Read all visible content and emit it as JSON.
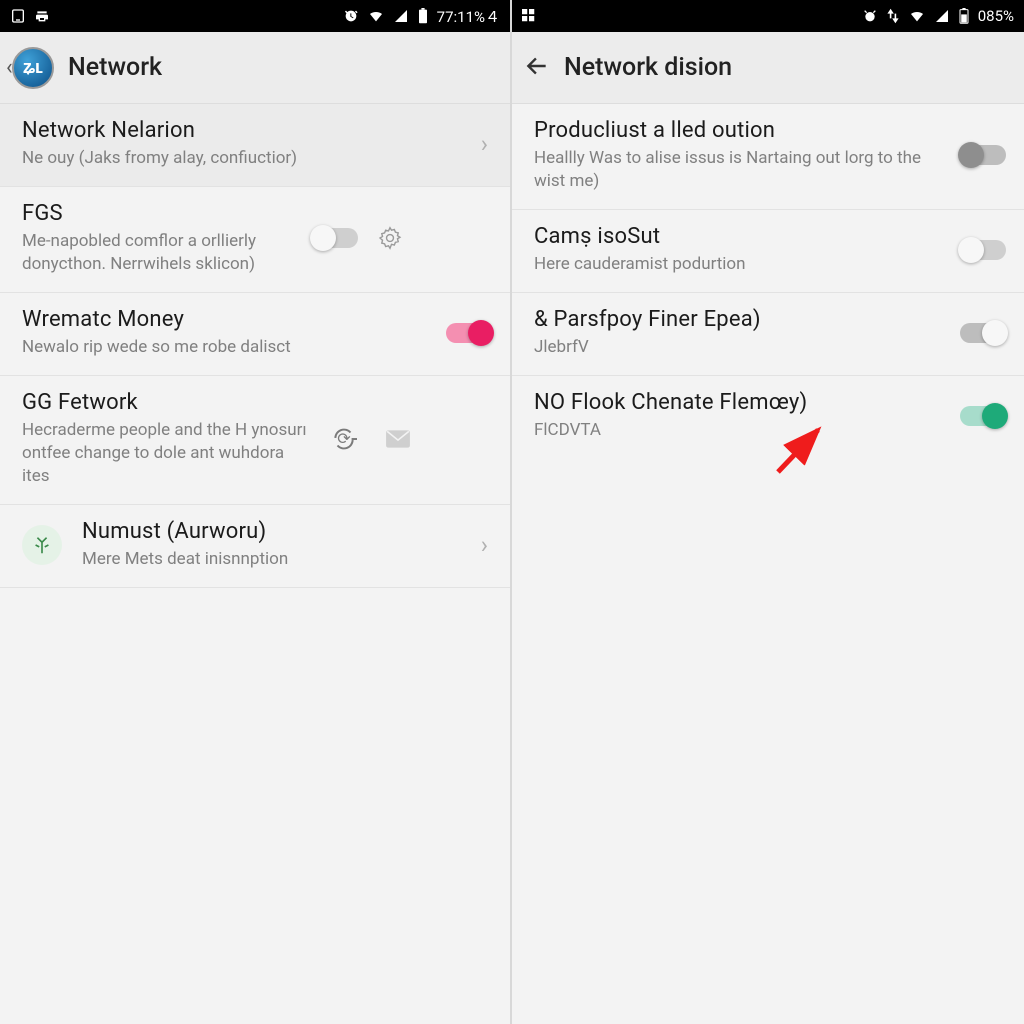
{
  "left": {
    "status": {
      "time": "77:11%４"
    },
    "appbar": {
      "title": "Network"
    },
    "rows": [
      {
        "title": "Network Nelarion",
        "sub": "Ne ouy (Jaks fromy alay, confiuctior)"
      },
      {
        "title": "FGS",
        "sub": "Me-napobled comflor a orllierly donycthon. Nerrwihels sklicon)"
      },
      {
        "title": "Wrematc Money",
        "sub": "Newalo rip wede so me robe dalisct"
      },
      {
        "title": "GG Fetwork",
        "sub": "Hecraderme people and the H ynosurı ontfee change to dole ant wuhdora ites"
      },
      {
        "title": "Numust (Aurworu)",
        "sub": "Mere Mets deat inisnnption"
      }
    ]
  },
  "right": {
    "status": {
      "time": "085%"
    },
    "appbar": {
      "title": "Network dision"
    },
    "rows": [
      {
        "title": "Producliust a lled oution",
        "sub": "Heallly Was to alise issus is Nartaing out lorg to the wist me)"
      },
      {
        "title": "Camṣ isoSut",
        "sub": "Here cauderamist podurtion"
      },
      {
        "title": "& Parsfpoy Finer Epea)",
        "sub": "JlebrfV"
      },
      {
        "title": "NO Flook Chenate Flemœy)",
        "sub": "FlCDVTA"
      }
    ]
  }
}
